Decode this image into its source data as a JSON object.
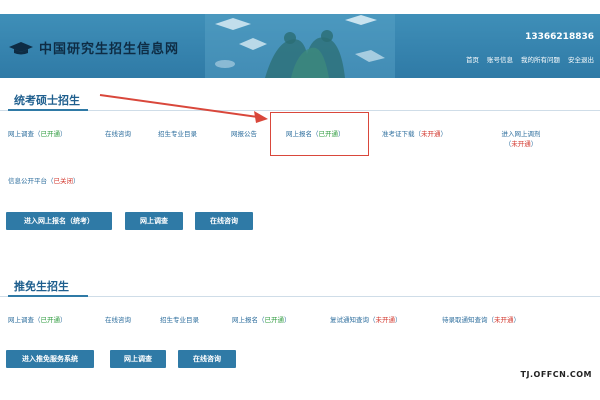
{
  "header": {
    "site_title": "中国研究生招生信息网",
    "phone": "13366218836",
    "nav": [
      "首页",
      "账号信息",
      "我的所有问题",
      "安全退出"
    ]
  },
  "section1": {
    "title": "统考硕士招生",
    "links": [
      {
        "label": "网上调查",
        "status": "已开通"
      },
      {
        "label": "在线咨询"
      },
      {
        "label": "招生专业目录"
      },
      {
        "label": "网报公告"
      },
      {
        "label": "网上报名",
        "status": "已开通"
      },
      {
        "label": "准考证下载",
        "status": "未开通"
      },
      {
        "label": "进入网上调剂",
        "status": "未开通"
      },
      {
        "label": "信息公开平台",
        "status": "已关闭"
      }
    ],
    "buttons": [
      "进入网上报名（统考）",
      "网上调查",
      "在线咨询"
    ]
  },
  "section2": {
    "title": "推免生招生",
    "links": [
      {
        "label": "网上调查",
        "status": "已开通"
      },
      {
        "label": "在线咨询"
      },
      {
        "label": "招生专业目录"
      },
      {
        "label": "网上报名",
        "status": "已开通"
      },
      {
        "label": "复试通知查询",
        "status": "未开通"
      },
      {
        "label": "待录取通知查询",
        "status": "未开通"
      }
    ],
    "buttons": [
      "进入推免服务系统",
      "网上调查",
      "在线咨询"
    ]
  },
  "watermark": "TJ.OFFCN.COM",
  "colors": {
    "header_bg": "#3f8fb8",
    "link": "#2f6f9e",
    "status_open": "#2e9b3e",
    "status_closed": "#d2352b",
    "button_bg": "#2f7aa6",
    "highlight": "#d9473b"
  }
}
